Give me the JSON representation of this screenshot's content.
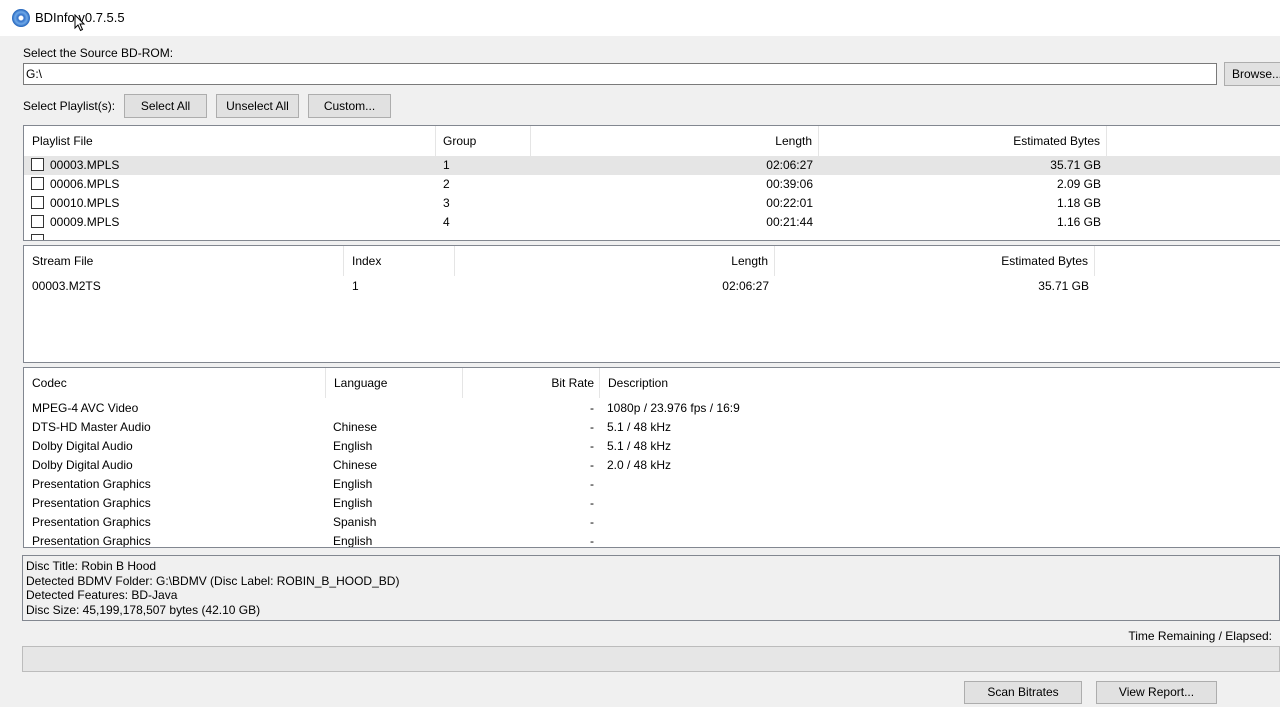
{
  "window": {
    "title": "BDInfo v0.7.5.5"
  },
  "source": {
    "label": "Select the Source BD-ROM:",
    "path": "G:\\",
    "browse_label": "Browse..."
  },
  "playlist_controls": {
    "label": "Select Playlist(s):",
    "select_all": "Select All",
    "unselect_all": "Unselect All",
    "custom": "Custom..."
  },
  "playlists": {
    "headers": [
      "Playlist File",
      "Group",
      "Length",
      "Estimated Bytes"
    ],
    "rows": [
      {
        "file": "00003.MPLS",
        "group": "1",
        "length": "02:06:27",
        "bytes": "35.71 GB"
      },
      {
        "file": "00006.MPLS",
        "group": "2",
        "length": "00:39:06",
        "bytes": "2.09 GB"
      },
      {
        "file": "00010.MPLS",
        "group": "3",
        "length": "00:22:01",
        "bytes": "1.18 GB"
      },
      {
        "file": "00009.MPLS",
        "group": "4",
        "length": "00:21:44",
        "bytes": "1.16 GB"
      }
    ]
  },
  "streams": {
    "headers": [
      "Stream File",
      "Index",
      "Length",
      "Estimated Bytes"
    ],
    "rows": [
      {
        "file": "00003.M2TS",
        "index": "1",
        "length": "02:06:27",
        "bytes": "35.71 GB"
      }
    ]
  },
  "codecs": {
    "headers": [
      "Codec",
      "Language",
      "Bit Rate",
      "Description"
    ],
    "rows": [
      {
        "codec": "MPEG-4 AVC Video",
        "language": "",
        "bitrate": "-",
        "description": "1080p / 23.976 fps / 16:9"
      },
      {
        "codec": "DTS-HD Master Audio",
        "language": "Chinese",
        "bitrate": "-",
        "description": "5.1 / 48 kHz"
      },
      {
        "codec": "Dolby Digital Audio",
        "language": "English",
        "bitrate": "-",
        "description": "5.1 / 48 kHz"
      },
      {
        "codec": "Dolby Digital Audio",
        "language": "Chinese",
        "bitrate": "-",
        "description": "2.0 / 48 kHz"
      },
      {
        "codec": "Presentation Graphics",
        "language": "English",
        "bitrate": "-",
        "description": ""
      },
      {
        "codec": "Presentation Graphics",
        "language": "English",
        "bitrate": "-",
        "description": ""
      },
      {
        "codec": "Presentation Graphics",
        "language": "Spanish",
        "bitrate": "-",
        "description": ""
      },
      {
        "codec": "Presentation Graphics",
        "language": "English",
        "bitrate": "-",
        "description": ""
      }
    ]
  },
  "disc_info": {
    "title": "Disc Title: Robin B Hood",
    "folder": "Detected BDMV Folder: G:\\BDMV (Disc Label: ROBIN_B_HOOD_BD)",
    "features": "Detected Features: BD-Java",
    "size": "Disc Size: 45,199,178,507 bytes (42.10 GB)"
  },
  "status": {
    "time_label": "Time Remaining / Elapsed:",
    "progress": 0
  },
  "actions": {
    "scan": "Scan Bitrates",
    "report": "View Report..."
  }
}
